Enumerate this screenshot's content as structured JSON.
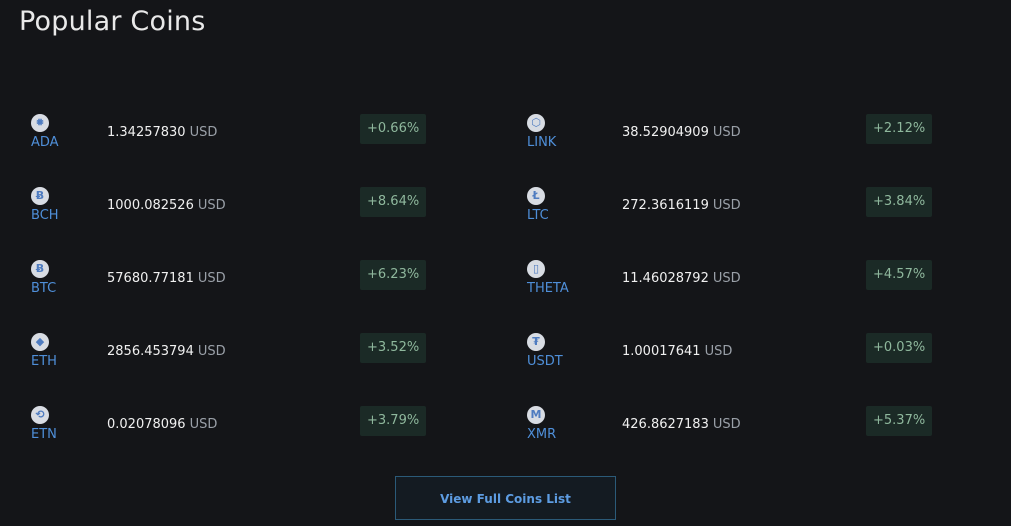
{
  "header": {
    "title": "Popular Coins"
  },
  "coins_left": [
    {
      "symbol": "ADA",
      "price": "1.34257830",
      "currency": "USD",
      "change": "+0.66%",
      "icon": "✹"
    },
    {
      "symbol": "BCH",
      "price": "1000.082526",
      "currency": "USD",
      "change": "+8.64%",
      "icon": "Ƀ"
    },
    {
      "symbol": "BTC",
      "price": "57680.77181",
      "currency": "USD",
      "change": "+6.23%",
      "icon": "Ƀ"
    },
    {
      "symbol": "ETH",
      "price": "2856.453794",
      "currency": "USD",
      "change": "+3.52%",
      "icon": "◆"
    },
    {
      "symbol": "ETN",
      "price": "0.02078096",
      "currency": "USD",
      "change": "+3.79%",
      "icon": "⟲"
    }
  ],
  "coins_right": [
    {
      "symbol": "LINK",
      "price": "38.52904909",
      "currency": "USD",
      "change": "+2.12%",
      "icon": "⬡"
    },
    {
      "symbol": "LTC",
      "price": "272.3616119",
      "currency": "USD",
      "change": "+3.84%",
      "icon": "Ł"
    },
    {
      "symbol": "THETA",
      "price": "11.46028792",
      "currency": "USD",
      "change": "+4.57%",
      "icon": "▯"
    },
    {
      "symbol": "USDT",
      "price": "1.00017641",
      "currency": "USD",
      "change": "+0.03%",
      "icon": "₮"
    },
    {
      "symbol": "XMR",
      "price": "426.8627183",
      "currency": "USD",
      "change": "+5.37%",
      "icon": "M"
    }
  ],
  "actions": {
    "view_full_list": "View Full Coins List"
  },
  "colors": {
    "background": "#141518",
    "symbol": "#4f8fd9",
    "change_text": "#8fb89d",
    "change_bg": "#1b2a26",
    "button_border": "#2b5a78",
    "button_text": "#5d9ce2"
  }
}
